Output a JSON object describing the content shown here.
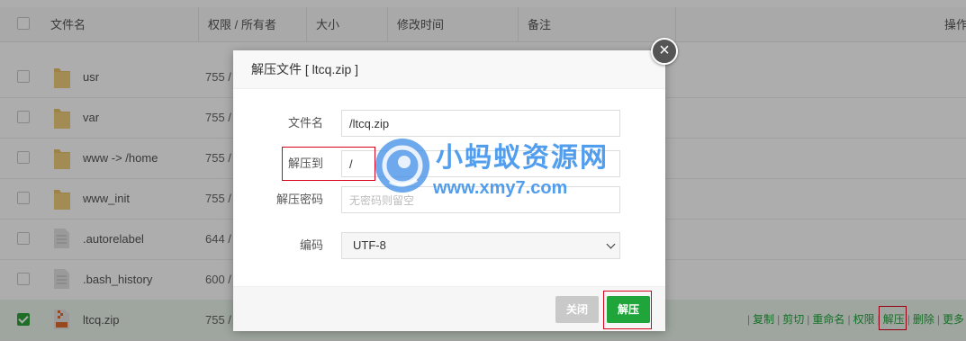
{
  "table": {
    "headers": {
      "name": "文件名",
      "perm": "权限 / 所有者",
      "size": "大小",
      "mtime": "修改时间",
      "note": "备注",
      "ops": "操作"
    },
    "rows": [
      {
        "name": "usr",
        "perm": "755 /",
        "type": "folder"
      },
      {
        "name": "var",
        "perm": "755 /",
        "type": "folder"
      },
      {
        "name": "www -> /home",
        "perm": "755 /",
        "type": "folder"
      },
      {
        "name": "www_init",
        "perm": "755 /",
        "type": "folder"
      },
      {
        "name": ".autorelabel",
        "perm": "644 /",
        "type": "file"
      },
      {
        "name": ".bash_history",
        "perm": "600 /",
        "type": "file"
      },
      {
        "name": "ltcq.zip",
        "perm": "755 /",
        "type": "zip",
        "selected": true
      }
    ],
    "actions": {
      "copy": "复制",
      "cut": "剪切",
      "rename": "重命名",
      "perm": "权限",
      "extract": "解压",
      "delete": "删除",
      "more": "更多"
    }
  },
  "modal": {
    "title": "解压文件 [ ltcq.zip ]",
    "close_symbol": "×",
    "fields": {
      "filename_label": "文件名",
      "filename_value": "/ltcq.zip",
      "extract_to_label": "解压到",
      "extract_to_value": "/",
      "password_label": "解压密码",
      "password_placeholder": "无密码则留空",
      "encoding_label": "编码",
      "encoding_value": "UTF-8"
    },
    "buttons": {
      "close": "关闭",
      "extract": "解压"
    }
  },
  "watermark": {
    "title": "小蚂蚁资源网",
    "url": "www.xmy7.com"
  },
  "colors": {
    "accent": "#20a53a",
    "highlight": "#d9001b",
    "folder": "#e8c26a"
  }
}
